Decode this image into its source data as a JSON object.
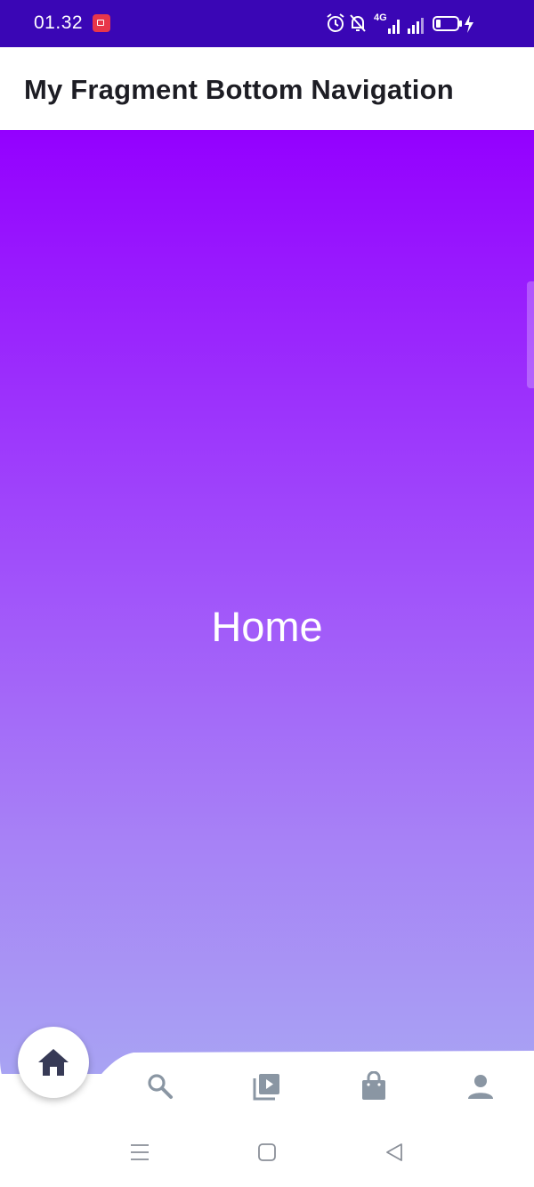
{
  "status_bar": {
    "time": "01.32",
    "network_label": "4G",
    "colors": {
      "background": "#3a06b5",
      "recording": "#e8364a"
    },
    "icons": [
      "screen-record-icon",
      "alarm-icon",
      "mute-icon",
      "signal-4g-icon",
      "signal-icon",
      "battery-icon",
      "charging-icon"
    ]
  },
  "app_bar": {
    "title": "My Fragment Bottom Navigation"
  },
  "content": {
    "label": "Home",
    "gradient": [
      "#9400ff",
      "#a8a3f3"
    ]
  },
  "bottom_nav": {
    "selected": "home",
    "items": [
      {
        "id": "home",
        "icon": "home-icon"
      },
      {
        "id": "search",
        "icon": "search-icon"
      },
      {
        "id": "video",
        "icon": "video-library-icon"
      },
      {
        "id": "shop",
        "icon": "shopping-bag-icon"
      },
      {
        "id": "profile",
        "icon": "person-icon"
      }
    ],
    "colors": {
      "selected_icon": "#373a56",
      "icon": "#8a96a3"
    }
  },
  "system_nav": {
    "icons": [
      "menu-icon",
      "home-square-icon",
      "back-icon"
    ]
  }
}
